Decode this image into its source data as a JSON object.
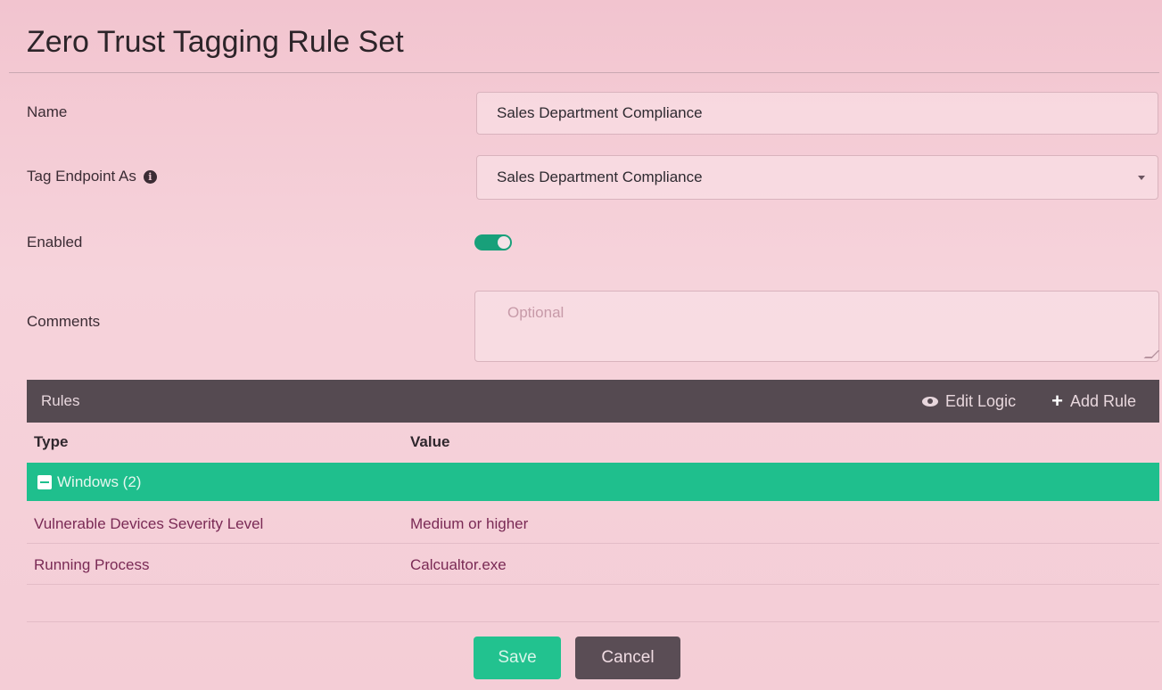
{
  "header": {
    "title": "Zero Trust Tagging Rule Set"
  },
  "form": {
    "name_label": "Name",
    "name_value": "Sales Department Compliance",
    "tag_label": "Tag Endpoint As",
    "tag_info_icon": "info-circle-icon",
    "tag_value": "Sales Department Compliance",
    "enabled_label": "Enabled",
    "enabled": true,
    "comments_label": "Comments",
    "comments_placeholder": "Optional"
  },
  "rules": {
    "title": "Rules",
    "edit_logic_label": "Edit Logic",
    "add_rule_label": "Add Rule",
    "columns": [
      "Type",
      "Value"
    ],
    "group": {
      "label": "Windows (2)",
      "expanded": true
    },
    "rows": [
      {
        "type": "Vulnerable Devices Severity Level",
        "value": "Medium or higher"
      },
      {
        "type": "Running Process",
        "value": "Calcualtor.exe"
      }
    ]
  },
  "actions": {
    "save_label": "Save",
    "cancel_label": "Cancel"
  },
  "colors": {
    "accent_green": "#1fbf8d",
    "toggle_green": "#18a07a",
    "bar_dark": "#554a51",
    "cancel_dark": "#5a4d55"
  }
}
